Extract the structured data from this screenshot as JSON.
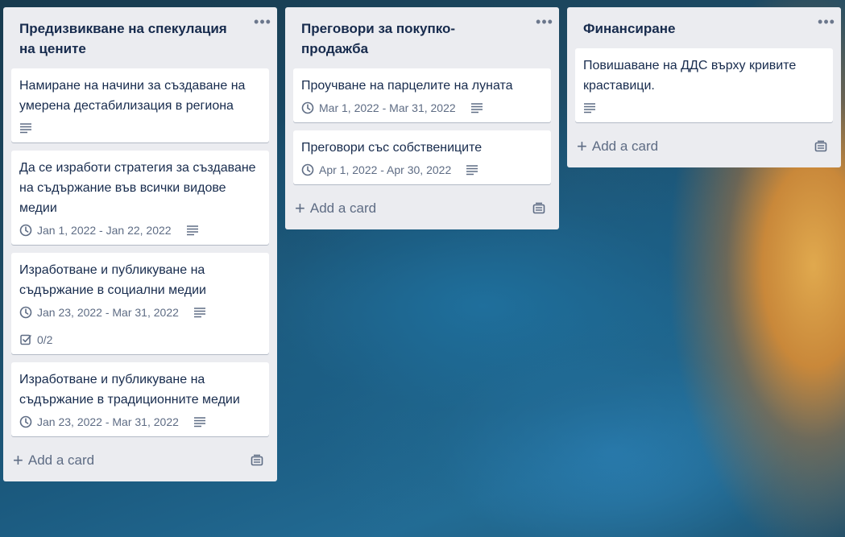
{
  "lists": [
    {
      "title": "Предизвикване на спекулация на цените",
      "cards": [
        {
          "title": "Намиране на начини за създаване на умерена дестабилизация в региона",
          "date": "",
          "has_description": true,
          "checklist": ""
        },
        {
          "title": "Да се изработи стратегия за създаване на съдържание във всички видове медии",
          "date": "Jan 1, 2022 - Jan 22, 2022",
          "has_description": true,
          "checklist": ""
        },
        {
          "title": "Изработване и публикуване на съдържание в социални медии",
          "date": "Jan 23, 2022 - Mar 31, 2022",
          "has_description": true,
          "checklist": "0/2"
        },
        {
          "title": "Изработване и публикуване на съдържание в традиционните медии",
          "date": "Jan 23, 2022 - Mar 31, 2022",
          "has_description": true,
          "checklist": ""
        }
      ],
      "add_card_label": "Add a card"
    },
    {
      "title": "Преговори за покупко-продажба",
      "cards": [
        {
          "title": "Проучване на парцелите на луната",
          "date": "Mar 1, 2022 - Mar 31, 2022",
          "has_description": true,
          "checklist": ""
        },
        {
          "title": "Преговори със собствениците",
          "date": "Apr 1, 2022 - Apr 30, 2022",
          "has_description": true,
          "checklist": ""
        }
      ],
      "add_card_label": "Add a card"
    },
    {
      "title": "Финансиране",
      "cards": [
        {
          "title": "Повишаване на ДДС върху кривите краставици.",
          "date": "",
          "has_description": true,
          "checklist": ""
        }
      ],
      "add_card_label": "Add a card"
    }
  ],
  "list_menu_icon": "more-horizontal-icon",
  "colors": {
    "list_bg": "#ebecf0",
    "card_text": "#172b4d",
    "badge_text": "#5e6c84"
  }
}
